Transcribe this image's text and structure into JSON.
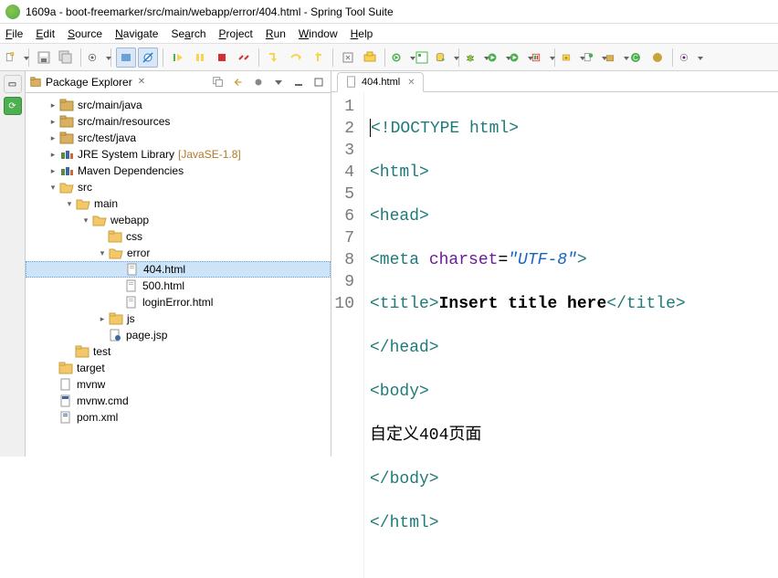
{
  "window": {
    "title": "1609a - boot-freemarker/src/main/webapp/error/404.html - Spring Tool Suite"
  },
  "menu": {
    "file": "File",
    "edit": "Edit",
    "source": "Source",
    "navigate": "Navigate",
    "search": "Search",
    "project": "Project",
    "run": "Run",
    "window": "Window",
    "help": "Help"
  },
  "explorer": {
    "title": "Package Explorer",
    "nodes": {
      "srcMainJava": "src/main/java",
      "srcMainResources": "src/main/resources",
      "srcTestJava": "src/test/java",
      "jre": "JRE System Library",
      "jreExtra": "[JavaSE-1.8]",
      "maven": "Maven Dependencies",
      "src": "src",
      "main": "main",
      "webapp": "webapp",
      "css": "css",
      "error": "error",
      "f404": "404.html",
      "f500": "500.html",
      "loginError": "loginError.html",
      "js": "js",
      "pagejsp": "page.jsp",
      "test": "test",
      "target": "target",
      "mvnw": "mvnw",
      "mvnwcmd": "mvnw.cmd",
      "pom": "pom.xml"
    }
  },
  "editor": {
    "tab": "404.html",
    "lines": [
      "1",
      "2",
      "3",
      "4",
      "5",
      "6",
      "7",
      "8",
      "9",
      "10"
    ],
    "code": {
      "l1a": "<!",
      "l1b": "DOCTYPE",
      "l1c": " html",
      "l1d": ">",
      "l2a": "<html>",
      "l3a": "<head>",
      "l4a": "<meta ",
      "l4b": "charset",
      "l4c": "=",
      "l4d": "\"UTF-8\"",
      "l4e": ">",
      "l5a": "<title>",
      "l5b": "Insert title here",
      "l5c": "</title>",
      "l6a": "</head>",
      "l7a": "<body>",
      "l8a": "自定义404页面",
      "l9a": "</body>",
      "l10a": "</html>"
    }
  }
}
